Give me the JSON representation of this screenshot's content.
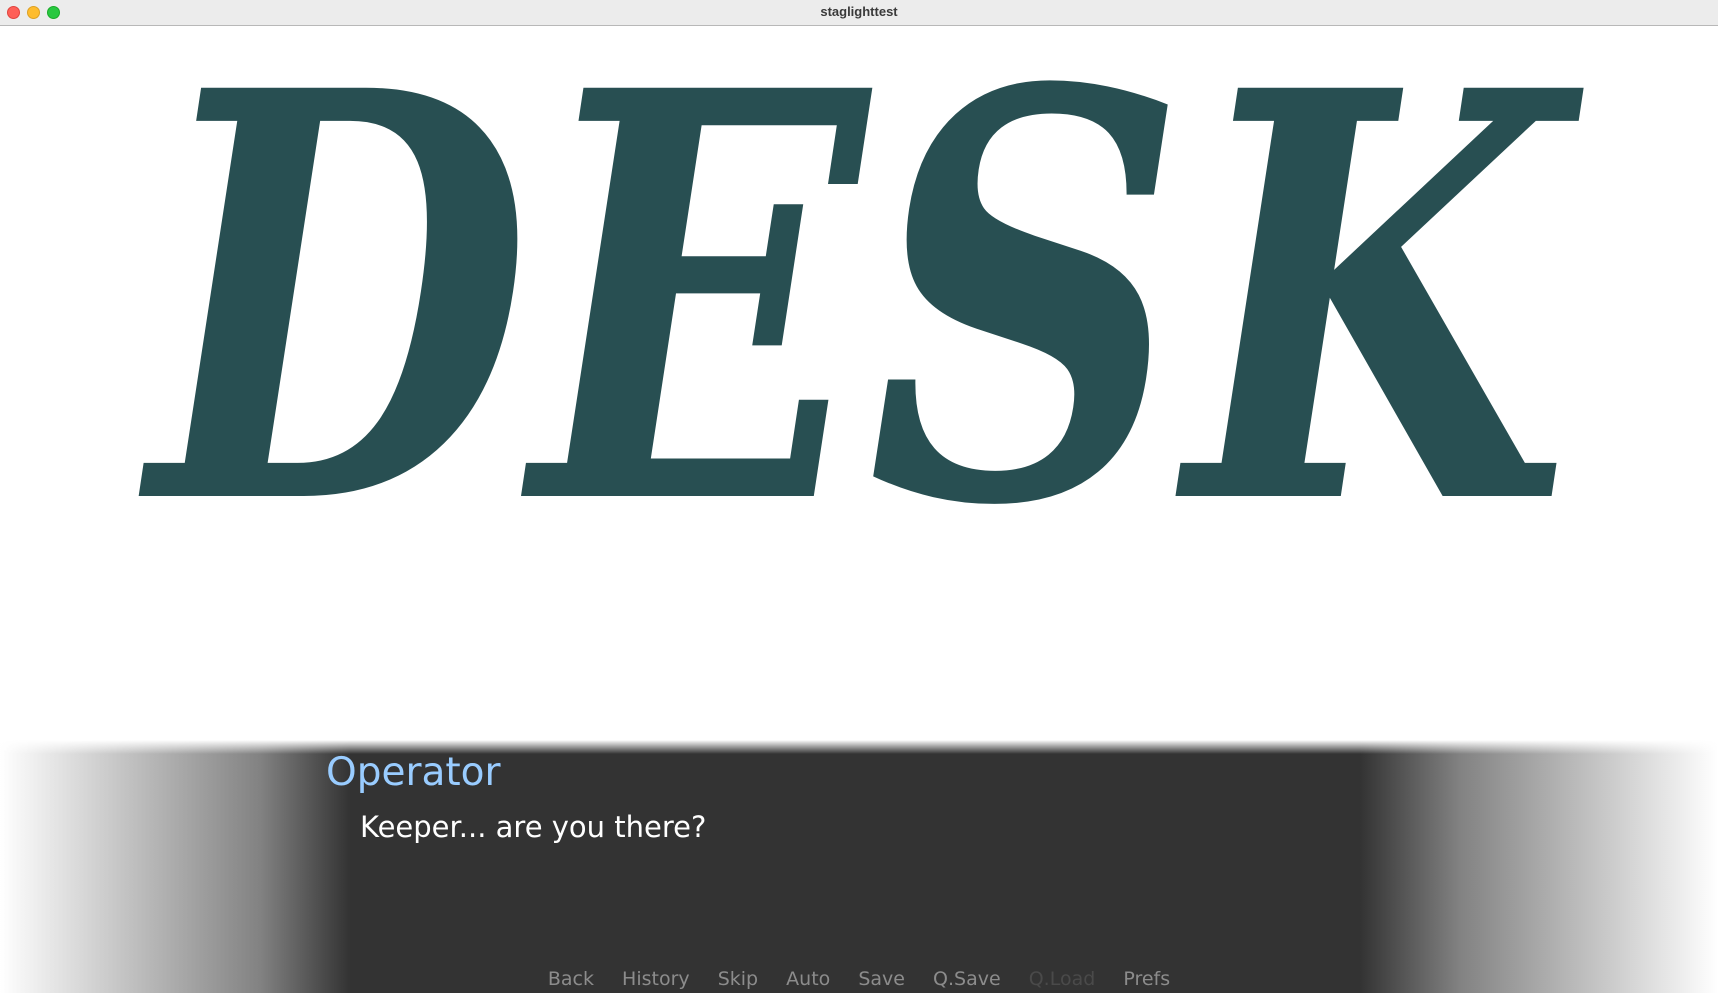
{
  "window": {
    "title": "staglighttest"
  },
  "scene": {
    "sign_text": "DESK",
    "sign_color": "#284f52",
    "background_color": "#ffffff"
  },
  "dialogue": {
    "speaker": "Operator",
    "speaker_color": "#99ccff",
    "text": "Keeper... are you there?",
    "text_color": "#ffffff",
    "box_color": "#333333"
  },
  "quick_menu": {
    "items": [
      {
        "label": "Back",
        "enabled": true
      },
      {
        "label": "History",
        "enabled": true
      },
      {
        "label": "Skip",
        "enabled": true
      },
      {
        "label": "Auto",
        "enabled": true
      },
      {
        "label": "Save",
        "enabled": true
      },
      {
        "label": "Q.Save",
        "enabled": true
      },
      {
        "label": "Q.Load",
        "enabled": false
      },
      {
        "label": "Prefs",
        "enabled": true
      }
    ]
  }
}
